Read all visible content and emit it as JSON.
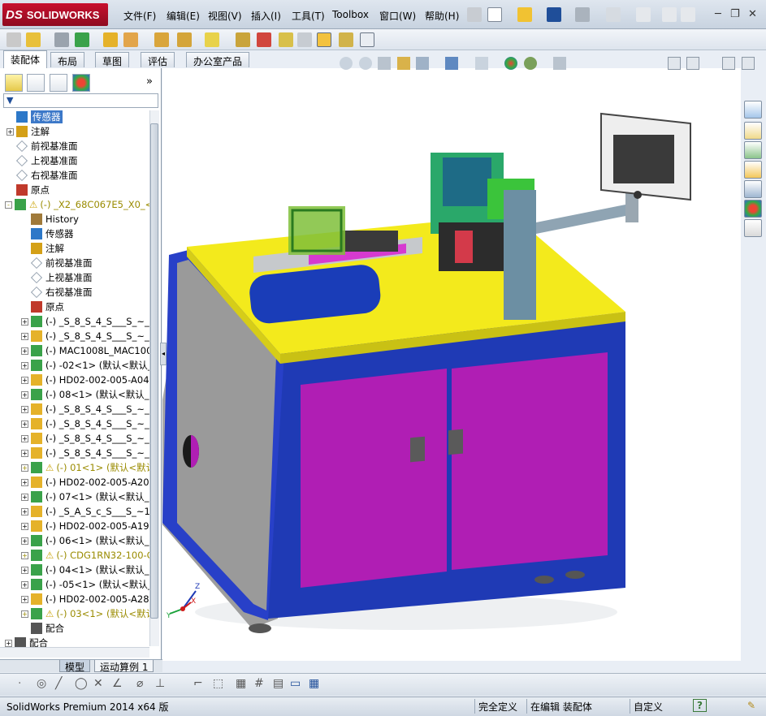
{
  "app": {
    "logo_prefix": "DS",
    "logo_text": "SOLIDWORKS",
    "accent": "#c8102e"
  },
  "menu": [
    "文件(F)",
    "编辑(E)",
    "视图(V)",
    "插入(I)",
    "工具(T)",
    "Toolbox",
    "窗口(W)",
    "帮助(H)"
  ],
  "command_tabs": [
    "装配体",
    "布局",
    "草图",
    "评估",
    "办公室产品"
  ],
  "feature_tree": {
    "rows": [
      {
        "label": "传感器",
        "icon": "sensor-icon",
        "indent": 1,
        "selected": true
      },
      {
        "label": "注解",
        "icon": "annotation-icon",
        "indent": 1,
        "expand": "+"
      },
      {
        "label": "前视基准面",
        "icon": "plane-icon",
        "indent": 1
      },
      {
        "label": "上视基准面",
        "icon": "plane-icon",
        "indent": 1
      },
      {
        "label": "右视基准面",
        "icon": "plane-icon",
        "indent": 1
      },
      {
        "label": "原点",
        "icon": "origin-icon",
        "indent": 1
      },
      {
        "label": "(-) _X2_68C067E5_X0_<",
        "icon": "subassembly-icon",
        "indent": 0,
        "expand": "-",
        "warning": true
      },
      {
        "label": "History",
        "icon": "history-icon",
        "indent": 2
      },
      {
        "label": "传感器",
        "icon": "sensor-icon",
        "indent": 2
      },
      {
        "label": "注解",
        "icon": "annotation-icon",
        "indent": 2
      },
      {
        "label": "前视基准面",
        "icon": "plane-icon",
        "indent": 2
      },
      {
        "label": "上视基准面",
        "icon": "plane-icon",
        "indent": 2
      },
      {
        "label": "右视基准面",
        "icon": "plane-icon",
        "indent": 2
      },
      {
        "label": "原点",
        "icon": "origin-icon",
        "indent": 2
      },
      {
        "label": "(-) _S_8_S_4_S___S_~_",
        "icon": "subassembly-icon",
        "indent": 2,
        "expand": "+"
      },
      {
        "label": "(-) _S_8_S_4_S___S_~_",
        "icon": "part-icon",
        "indent": 2,
        "expand": "+"
      },
      {
        "label": "(-) MAC1008L_MAC1008",
        "icon": "subassembly-icon",
        "indent": 2,
        "expand": "+"
      },
      {
        "label": "(-) -02<1> (默认<默认_",
        "icon": "subassembly-icon",
        "indent": 2,
        "expand": "+"
      },
      {
        "label": "(-) HD02-002-005-A04<1",
        "icon": "part-icon",
        "indent": 2,
        "expand": "+"
      },
      {
        "label": "(-) 08<1> (默认<默认_",
        "icon": "subassembly-icon",
        "indent": 2,
        "expand": "+"
      },
      {
        "label": "(-) _S_8_S_4_S___S_~_",
        "icon": "part-icon",
        "indent": 2,
        "expand": "+"
      },
      {
        "label": "(-) _S_8_S_4_S___S_~_",
        "icon": "part-icon",
        "indent": 2,
        "expand": "+"
      },
      {
        "label": "(-) _S_8_S_4_S___S_~_",
        "icon": "part-icon",
        "indent": 2,
        "expand": "+"
      },
      {
        "label": "(-) _S_8_S_4_S___S_~_",
        "icon": "part-icon",
        "indent": 2,
        "expand": "+"
      },
      {
        "label": "(-) 01<1> (默认<默认",
        "icon": "subassembly-icon",
        "indent": 2,
        "expand": "+",
        "warning": true
      },
      {
        "label": "(-) HD02-002-005-A20<1",
        "icon": "part-icon",
        "indent": 2,
        "expand": "+"
      },
      {
        "label": "(-) 07<1> (默认<默认_",
        "icon": "subassembly-icon",
        "indent": 2,
        "expand": "+"
      },
      {
        "label": "(-) _S_A_S_c_S___S_~1",
        "icon": "part-icon",
        "indent": 2,
        "expand": "+"
      },
      {
        "label": "(-) HD02-002-005-A19<1",
        "icon": "part-icon",
        "indent": 2,
        "expand": "+"
      },
      {
        "label": "(-) 06<1> (默认<默认_",
        "icon": "subassembly-icon",
        "indent": 2,
        "expand": "+"
      },
      {
        "label": "(-) CDG1RN32-100-C",
        "icon": "subassembly-icon",
        "indent": 2,
        "expand": "+",
        "warning": true
      },
      {
        "label": "(-) 04<1> (默认<默认_",
        "icon": "subassembly-icon",
        "indent": 2,
        "expand": "+"
      },
      {
        "label": "(-) -05<1> (默认<默认_",
        "icon": "subassembly-icon",
        "indent": 2,
        "expand": "+"
      },
      {
        "label": "(-) HD02-002-005-A28<1",
        "icon": "part-icon",
        "indent": 2,
        "expand": "+"
      },
      {
        "label": "(-) 03<1> (默认<默认",
        "icon": "subassembly-icon",
        "indent": 2,
        "expand": "+",
        "warning": true
      },
      {
        "label": "配合",
        "icon": "mate-icon",
        "indent": 2
      },
      {
        "label": "配合",
        "icon": "mate-icon",
        "indent": 0,
        "expand": "+"
      }
    ]
  },
  "bottom_tabs": [
    "模型",
    "运动算例 1"
  ],
  "status": {
    "product": "SolidWorks Premium 2014 x64 版",
    "definition": "完全定义",
    "mode": "在编辑 装配体",
    "units": "自定义",
    "help_badge": "?"
  },
  "triad": {
    "x": "X",
    "y": "Y",
    "z": "Z"
  }
}
